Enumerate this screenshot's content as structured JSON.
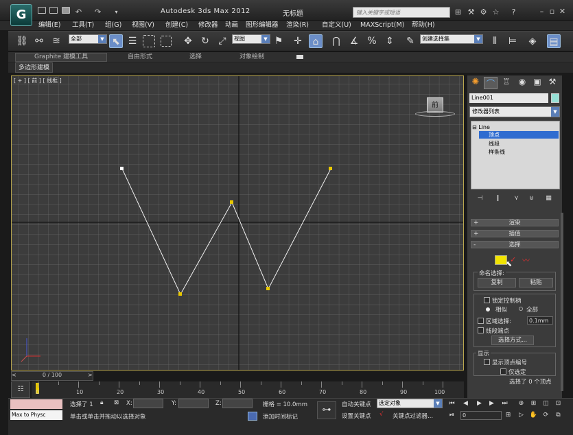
{
  "title_bar": {
    "app_title": "Autodesk 3ds Max  2012",
    "doc_title": "无标题",
    "search_placeholder": "键入关键字或短语"
  },
  "menus": [
    {
      "label": "编辑(E)"
    },
    {
      "label": "工具(T)"
    },
    {
      "label": "组(G)"
    },
    {
      "label": "视图(V)"
    },
    {
      "label": "创建(C)"
    },
    {
      "label": "修改器"
    },
    {
      "label": "动画"
    },
    {
      "label": "图形编辑器"
    },
    {
      "label": "渲染(R)"
    },
    {
      "label": "自定义(U)"
    },
    {
      "label": "MAXScript(M)"
    },
    {
      "label": "帮助(H)"
    }
  ],
  "toolbar": {
    "selection_filter": "全部",
    "reference_coord": "视图",
    "named_selection": "创建选择集"
  },
  "ribbon": {
    "tabs": [
      "Graphite 建模工具",
      "自由形式",
      "选择",
      "对象绘制"
    ],
    "sub_tab": "多边形建模"
  },
  "viewport": {
    "label": "[ + ] [ 前 ] [ 线框 ]",
    "viewcube_face": "前",
    "accent": "#b8a64e"
  },
  "timeline": {
    "frame_display": "0 / 100",
    "ticks": [
      "0",
      "10",
      "20",
      "30",
      "40",
      "50",
      "60",
      "70",
      "80",
      "90",
      "100"
    ]
  },
  "command_panel": {
    "object_name": "Line001",
    "object_color": "#96e0d6",
    "modifier_list": "修改器列表",
    "stack": {
      "root": "Line",
      "items": [
        "顶点",
        "线段",
        "样条线"
      ],
      "selected": "顶点"
    },
    "rollouts": {
      "render": "渲染",
      "interpolation": "插值",
      "selection": "选择"
    },
    "named_selection": {
      "label": "命名选择:",
      "copy": "复制",
      "paste": "粘贴"
    },
    "lock_handles": "锁定控制柄",
    "alike": "相似",
    "all": "全部",
    "area_selection": "区域选择:",
    "area_value": "0.1mm",
    "segment_end": "线段端点",
    "select_by": "选择方式...",
    "display_group": "显示",
    "show_vertex_numbers": "显示顶点编号",
    "selected_only": "仅选定",
    "selected_count": "选择了 0 个顶点"
  },
  "status": {
    "maxscript_listener": "Max to Physc",
    "selected_text": "选择了 1",
    "x_label": "X:",
    "y_label": "Y:",
    "z_label": "Z:",
    "grid": "栅格 = 10.0mm",
    "prompt": "单击或单击并拖动以选择对象",
    "add_time_tag": "添加时间标记",
    "auto_key": "自动关键点",
    "set_key": "设置关键点",
    "key_mode": "选定对象",
    "key_filters": "关键点过滤器...",
    "current_frame": "0"
  }
}
